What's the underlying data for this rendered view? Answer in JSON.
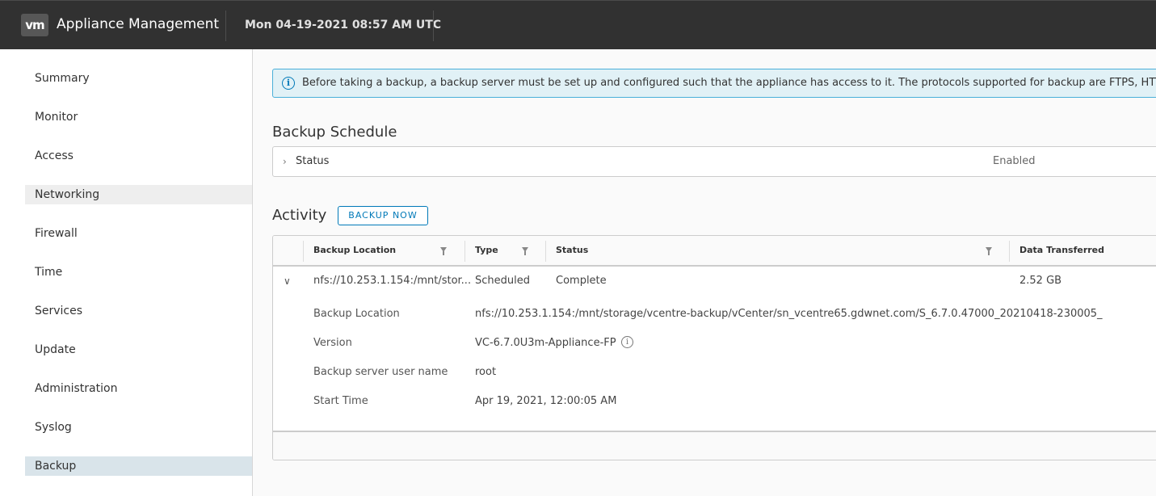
{
  "header": {
    "logo_text": "vm",
    "app_title": "Appliance Management",
    "datetime": "Mon 04-19-2021 08:57 AM UTC"
  },
  "sidebar": {
    "items": [
      {
        "label": "Summary"
      },
      {
        "label": "Monitor"
      },
      {
        "label": "Access"
      },
      {
        "label": "Networking"
      },
      {
        "label": "Firewall"
      },
      {
        "label": "Time"
      },
      {
        "label": "Services"
      },
      {
        "label": "Update"
      },
      {
        "label": "Administration"
      },
      {
        "label": "Syslog"
      },
      {
        "label": "Backup"
      }
    ],
    "active": "Backup"
  },
  "alert": {
    "text": "Before taking a backup, a backup server must be set up and configured such that the appliance has access to it. The protocols supported for backup are FTPS, HTTPS, SCP, FTP, NFS, SMB and HTTP."
  },
  "schedule": {
    "title": "Backup Schedule",
    "status_label": "Status",
    "status_value": "Enabled"
  },
  "activity": {
    "title": "Activity",
    "backup_now_label": "BACKUP NOW",
    "columns": [
      "Backup Location",
      "Type",
      "Status",
      "Data Transferred"
    ],
    "row": {
      "location": "nfs://10.253.1.154:/mnt/stor...",
      "type": "Scheduled",
      "status": "Complete",
      "data_transferred": "2.52 GB"
    },
    "details": [
      {
        "label": "Backup Location",
        "value": "nfs://10.253.1.154:/mnt/storage/vcentre-backup/vCenter/sn_vcentre65.gdwnet.com/S_6.7.0.47000_20210418-230005_"
      },
      {
        "label": "Version",
        "value": "VC-6.7.0U3m-Appliance-FP"
      },
      {
        "label": "Backup server user name",
        "value": "root"
      },
      {
        "label": "Start Time",
        "value": "Apr 19, 2021, 12:00:05 AM"
      }
    ]
  },
  "colors": {
    "header_bg": "#313131",
    "accent": "#0079b8",
    "alert_bg": "#e1f1f6",
    "nav_active_bg": "#d9e4ea"
  }
}
